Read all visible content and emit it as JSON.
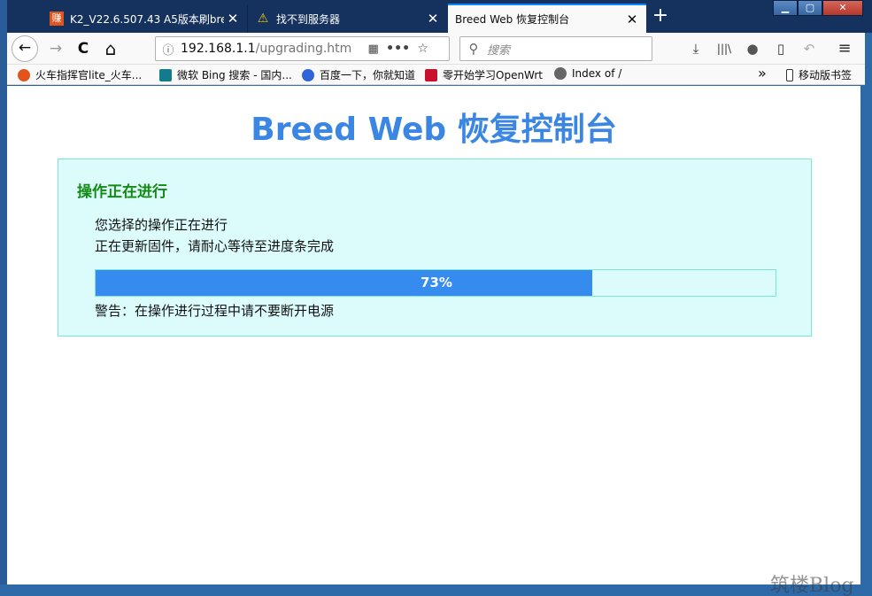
{
  "browser": {
    "tabs": [
      {
        "title": "K2_V22.6.507.43 A5版本刷bre",
        "favicon_text": "赚",
        "close": "✕",
        "active": false
      },
      {
        "title": "找不到服务器",
        "favicon_text": "⚠",
        "close": "✕",
        "active": false
      },
      {
        "title": "Breed Web 恢复控制台",
        "favicon_text": "",
        "close": "✕",
        "active": true
      }
    ],
    "new_tab": "+",
    "window_buttons": {
      "minimize": "▁",
      "maximize": "▢",
      "close": "✕"
    },
    "nav": {
      "back": "←",
      "forward": "→",
      "reload": "C",
      "home": "⌂",
      "url_host": "192.168.1.1",
      "url_path": "/upgrading.htm",
      "page_actions": "•••",
      "bookmark_star": "☆",
      "search_placeholder": "搜索",
      "tools": {
        "downloads": "⤓",
        "library": "|||\\",
        "chat": "●",
        "sidebar": "▯",
        "undo": "↶",
        "menu": "≡"
      }
    },
    "bookmarks": [
      {
        "label": "火车指挥官lite_火车...",
        "color": "#e0551f"
      },
      {
        "label": "微软 Bing 搜索 - 国内...",
        "color": "#107c8c"
      },
      {
        "label": "百度一下，你就知道",
        "color": "#2f65d8"
      },
      {
        "label": "零开始学习OpenWrt",
        "color": "#c8102e"
      },
      {
        "label": "Index of /",
        "color": "#666666"
      }
    ],
    "bookmarks_overflow": "»",
    "mobile_bookmarks": "移动版书签"
  },
  "page": {
    "title": "Breed Web 恢复控制台",
    "panel": {
      "heading": "操作正在进行",
      "line1": "您选择的操作正在进行",
      "line2": "正在更新固件，请耐心等待至进度条完成",
      "progress_value": 73,
      "progress_label": "73%",
      "warning": "警告：在操作进行过程中请不要断开电源"
    }
  },
  "watermark": "筑楼Blog",
  "colors": {
    "title": "#3b86e3",
    "heading": "#138a13",
    "panel_bg": "#dcfcfb",
    "panel_border": "#7ae7d2",
    "progress_fill": "#358cee"
  }
}
